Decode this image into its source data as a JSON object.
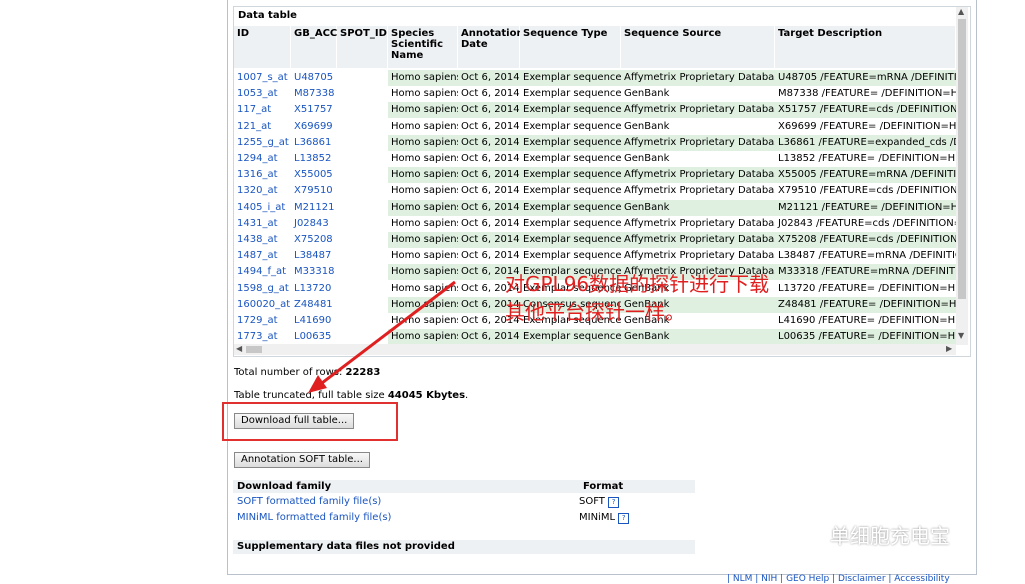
{
  "data_table": {
    "title": "Data table",
    "headers": [
      "ID",
      "GB_ACC",
      "SPOT_ID",
      "Species Scientific Name",
      "Annotation Date",
      "Sequence Type",
      "Sequence Source",
      "Target Description"
    ],
    "rows": [
      [
        "1007_s_at",
        "U48705",
        "",
        "Homo sapiens",
        "Oct 6, 2014",
        "Exemplar sequence",
        "Affymetrix Proprietary Database",
        "U48705 /FEATURE=mRNA /DEFINITIC"
      ],
      [
        "1053_at",
        "M87338",
        "",
        "Homo sapiens",
        "Oct 6, 2014",
        "Exemplar sequence",
        "GenBank",
        "M87338 /FEATURE= /DEFINITION=HU"
      ],
      [
        "117_at",
        "X51757",
        "",
        "Homo sapiens",
        "Oct 6, 2014",
        "Exemplar sequence",
        "Affymetrix Proprietary Database",
        "X51757 /FEATURE=cds /DEFINITION="
      ],
      [
        "121_at",
        "X69699",
        "",
        "Homo sapiens",
        "Oct 6, 2014",
        "Exemplar sequence",
        "GenBank",
        "X69699 /FEATURE= /DEFINITION=HS"
      ],
      [
        "1255_g_at",
        "L36861",
        "",
        "Homo sapiens",
        "Oct 6, 2014",
        "Exemplar sequence",
        "Affymetrix Proprietary Database",
        "L36861 /FEATURE=expanded_cds /DE"
      ],
      [
        "1294_at",
        "L13852",
        "",
        "Homo sapiens",
        "Oct 6, 2014",
        "Exemplar sequence",
        "GenBank",
        "L13852 /FEATURE= /DEFINITION=HU"
      ],
      [
        "1316_at",
        "X55005",
        "",
        "Homo sapiens",
        "Oct 6, 2014",
        "Exemplar sequence",
        "Affymetrix Proprietary Database",
        "X55005 /FEATURE=mRNA /DEFINITIC"
      ],
      [
        "1320_at",
        "X79510",
        "",
        "Homo sapiens",
        "Oct 6, 2014",
        "Exemplar sequence",
        "Affymetrix Proprietary Database",
        "X79510 /FEATURE=cds /DEFINITION="
      ],
      [
        "1405_i_at",
        "M21121",
        "",
        "Homo sapiens",
        "Oct 6, 2014",
        "Exemplar sequence",
        "GenBank",
        "M21121 /FEATURE= /DEFINITION=HU"
      ],
      [
        "1431_at",
        "J02843",
        "",
        "Homo sapiens",
        "Oct 6, 2014",
        "Exemplar sequence",
        "Affymetrix Proprietary Database",
        "J02843 /FEATURE=cds /DEFINITION="
      ],
      [
        "1438_at",
        "X75208",
        "",
        "Homo sapiens",
        "Oct 6, 2014",
        "Exemplar sequence",
        "Affymetrix Proprietary Database",
        "X75208 /FEATURE=cds /DEFINITION="
      ],
      [
        "1487_at",
        "L38487",
        "",
        "Homo sapiens",
        "Oct 6, 2014",
        "Exemplar sequence",
        "Affymetrix Proprietary Database",
        "L38487 /FEATURE=mRNA /DEFINITIC"
      ],
      [
        "1494_f_at",
        "M33318",
        "",
        "Homo sapiens",
        "Oct 6, 2014",
        "Exemplar sequence",
        "Affymetrix Proprietary Database",
        "M33318 /FEATURE=mRNA /DEFINITIC"
      ],
      [
        "1598_g_at",
        "L13720",
        "",
        "Homo sapiens",
        "Oct 6, 2014",
        "Exemplar sequence",
        "GenBank",
        "L13720 /FEATURE= /DEFINITION=HU"
      ],
      [
        "160020_at",
        "Z48481",
        "",
        "Homo sapiens",
        "Oct 6, 2014",
        "Consensus sequence",
        "GenBank",
        "Z48481 /FEATURE= /DEFINITION=HU"
      ],
      [
        "1729_at",
        "L41690",
        "",
        "Homo sapiens",
        "Oct 6, 2014",
        "Exemplar sequence",
        "GenBank",
        "L41690 /FEATURE= /DEFINITION=HU"
      ],
      [
        "1773_at",
        "L00635",
        "",
        "Homo sapiens",
        "Oct 6, 2014",
        "Exemplar sequence",
        "GenBank",
        "L00635 /FEATURE= /DEFINITION=HU"
      ]
    ]
  },
  "summary": {
    "rows_label": "Total number of rows:",
    "rows_value": "22283",
    "truncated_label": "Table truncated, full table size",
    "truncated_value": "44045 Kbytes",
    "truncated_suffix": "."
  },
  "buttons": {
    "download_full": "Download full table...",
    "annotation_soft": "Annotation SOFT table..."
  },
  "download_family": {
    "header_left": "Download family",
    "header_right": "Format",
    "items": [
      {
        "label": "SOFT formatted family file(s)",
        "format": "SOFT"
      },
      {
        "label": "MINiML formatted family file(s)",
        "format": "MINiML"
      }
    ]
  },
  "supplementary": "Supplementary data files not provided",
  "annotation": {
    "line1": "对GPL96数据的探针进行下载",
    "line2": "其他平台探针一样。",
    "color": "#e02020"
  },
  "watermark": "单细胞充电宝",
  "footer": "| NLM | NIH | GEO Help | Disclaimer | Accessibility"
}
